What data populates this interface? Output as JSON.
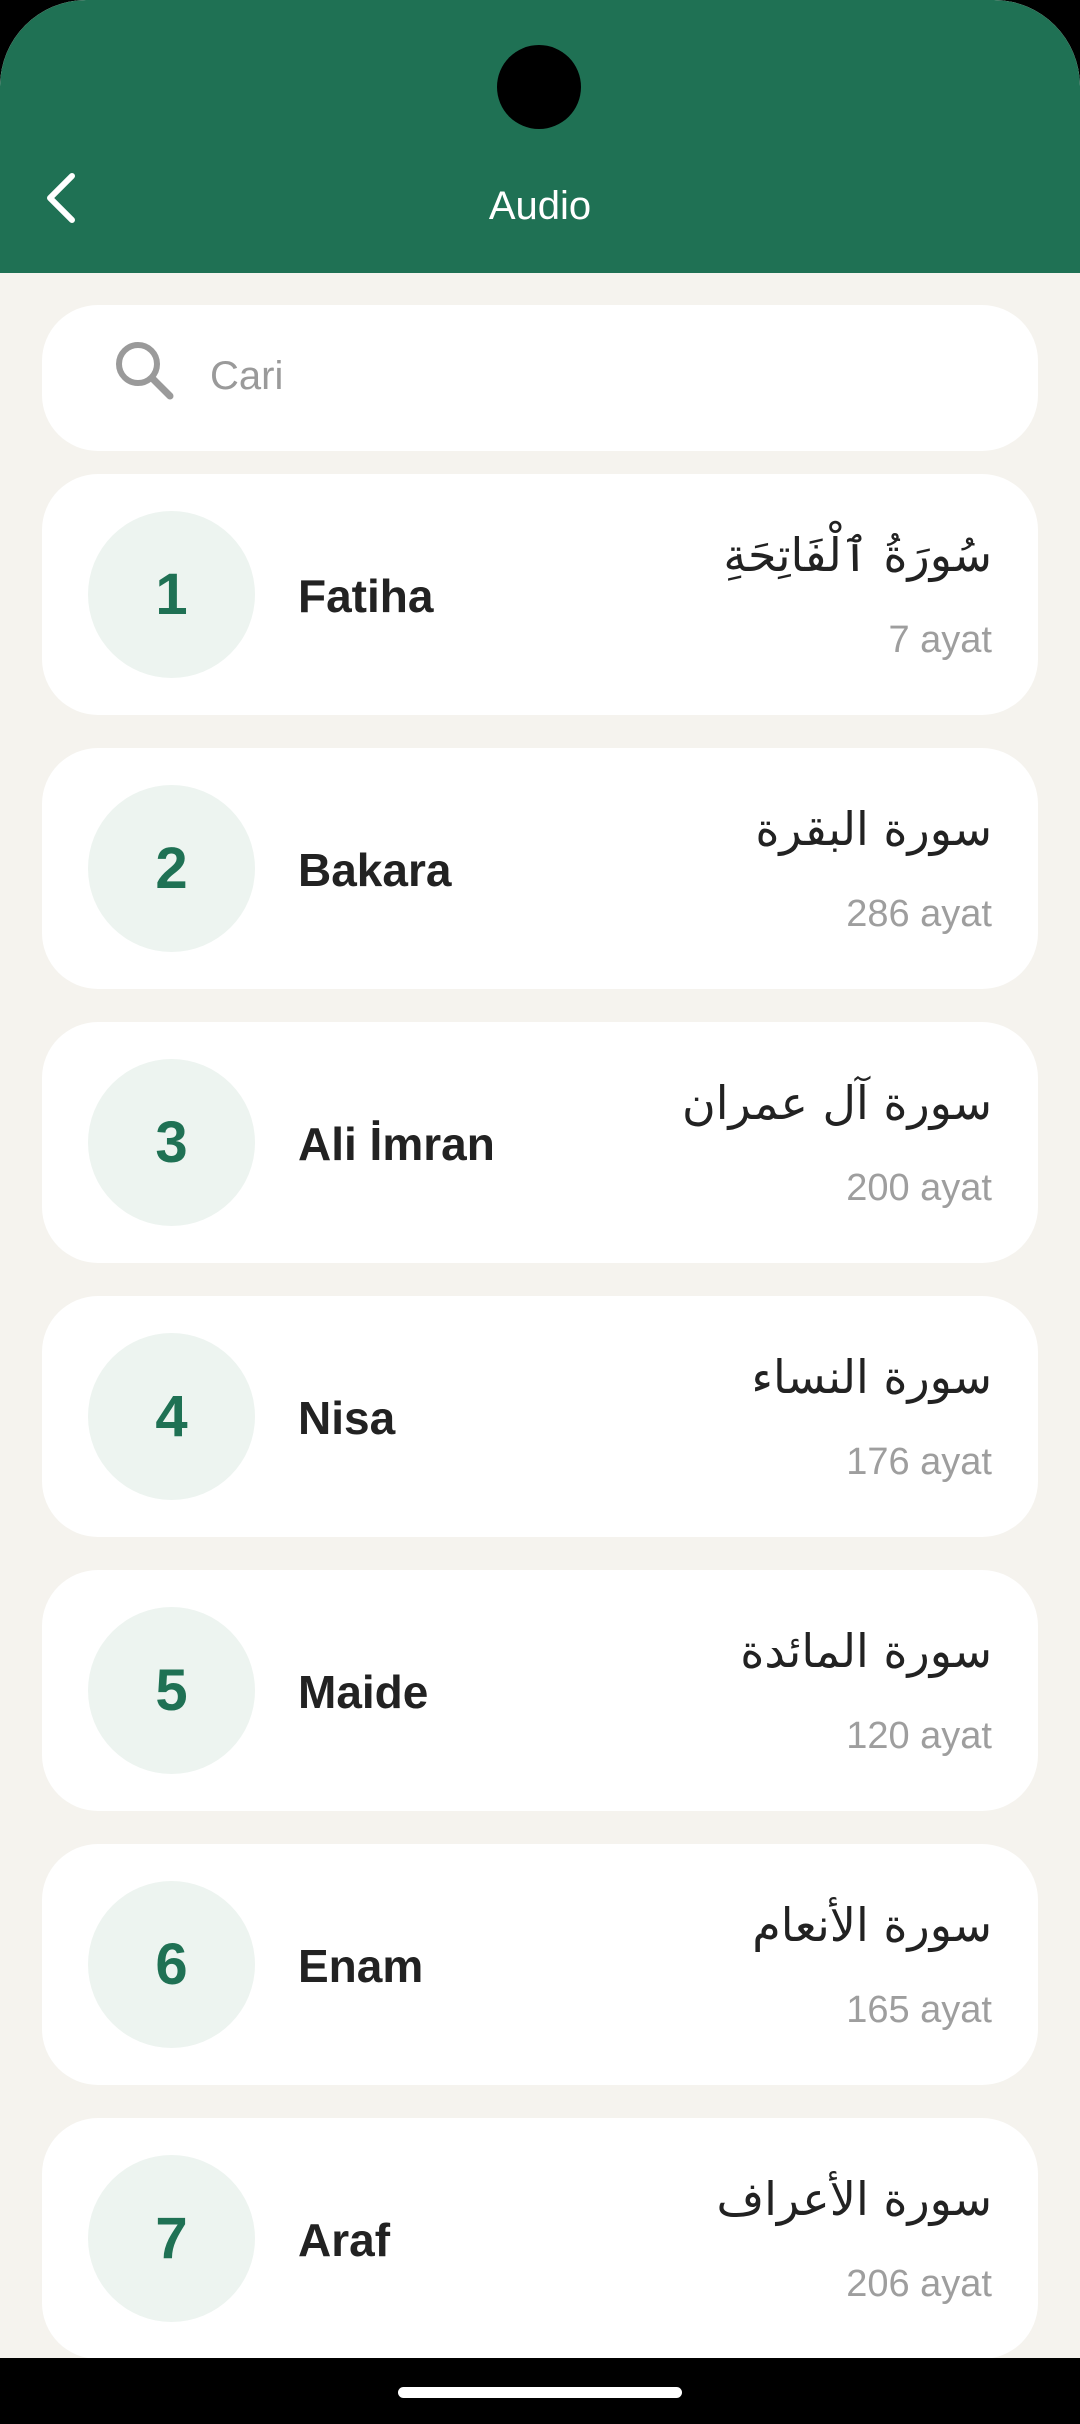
{
  "appbar": {
    "title": "Audio"
  },
  "search": {
    "placeholder": "Cari"
  },
  "surahs": [
    {
      "number": "1",
      "name": "Fatiha",
      "arabic": "سُورَةُ ٱلْفَاتِحَةِ",
      "ayat": "7 ayat"
    },
    {
      "number": "2",
      "name": "Bakara",
      "arabic": "سورة البقرة",
      "ayat": "286 ayat"
    },
    {
      "number": "3",
      "name": "Ali İmran",
      "arabic": "سورة آل عمران",
      "ayat": "200 ayat"
    },
    {
      "number": "4",
      "name": "Nisa",
      "arabic": "سورة النساء",
      "ayat": "176 ayat"
    },
    {
      "number": "5",
      "name": "Maide",
      "arabic": "سورة المائدة",
      "ayat": "120 ayat"
    },
    {
      "number": "6",
      "name": "Enam",
      "arabic": "سورة الأنعام",
      "ayat": "165 ayat"
    },
    {
      "number": "7",
      "name": "Araf",
      "arabic": "سورة الأعراف",
      "ayat": "206 ayat"
    }
  ],
  "colors": {
    "primary": "#1f7154",
    "background": "#f5f3ee",
    "card": "#ffffff",
    "circle": "#edf4f0",
    "muted": "#9e9e9e"
  }
}
